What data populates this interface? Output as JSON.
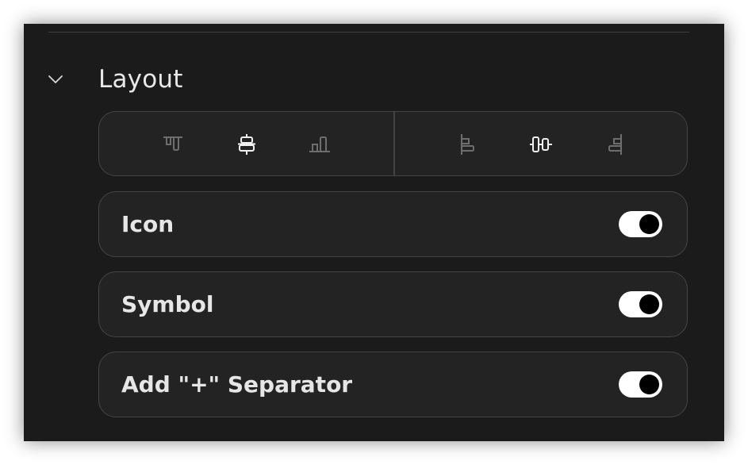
{
  "section": {
    "title": "Layout",
    "expanded": true,
    "chevron_icon": "chevron-down-icon"
  },
  "alignment": {
    "vertical": [
      {
        "name": "align-top",
        "icon": "align-top-icon",
        "selected": false
      },
      {
        "name": "align-middle",
        "icon": "align-vertical-center-icon",
        "selected": true
      },
      {
        "name": "align-bottom",
        "icon": "align-bottom-icon",
        "selected": false
      }
    ],
    "horizontal": [
      {
        "name": "align-left",
        "icon": "align-left-icon",
        "selected": false
      },
      {
        "name": "align-center",
        "icon": "align-horizontal-center-icon",
        "selected": true
      },
      {
        "name": "align-right",
        "icon": "align-right-icon",
        "selected": false
      }
    ]
  },
  "options": [
    {
      "label": "Icon",
      "enabled": true
    },
    {
      "label": "Symbol",
      "enabled": true
    },
    {
      "label": "Add \"+\" Separator",
      "enabled": true
    }
  ],
  "colors": {
    "panel_bg": "#1b1b1b",
    "row_bg": "#232323",
    "border": "#454545",
    "text": "#e6e6e6",
    "icon_active": "#f0f0f0",
    "icon_inactive": "#6e6e6e",
    "toggle_on": "#ffffff",
    "toggle_knob": "#000000"
  }
}
